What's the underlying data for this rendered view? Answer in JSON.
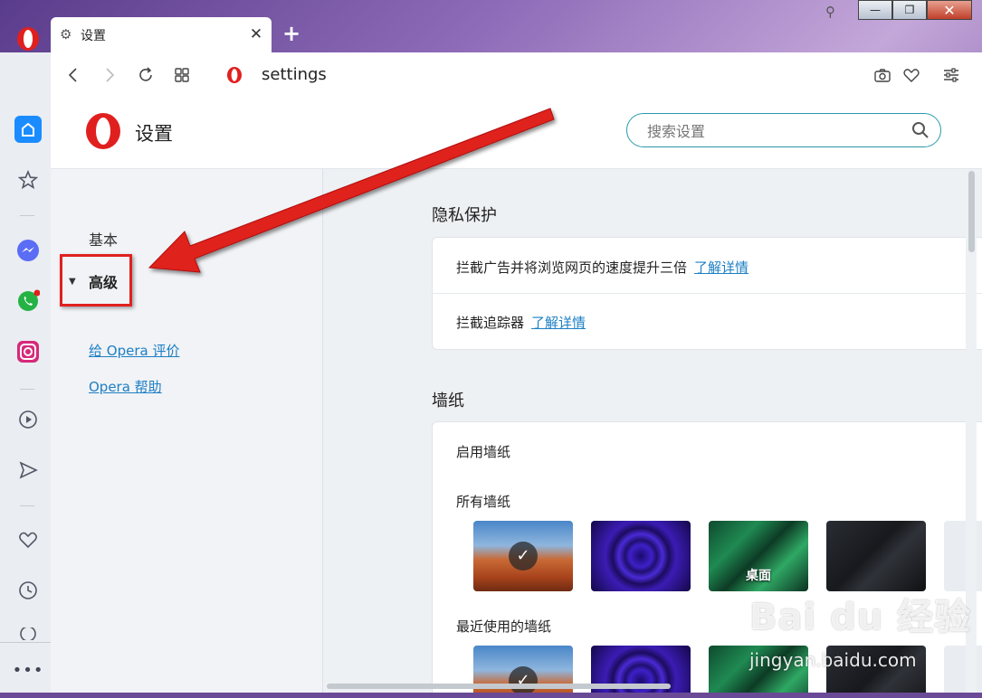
{
  "tab": {
    "title": "设置"
  },
  "address": {
    "text": "settings"
  },
  "header": {
    "title": "设置",
    "search_placeholder": "搜索设置"
  },
  "nav": {
    "basic": "基本",
    "advanced": "高级",
    "rate_link": "给 Opera 评价",
    "help_link": "Opera 帮助"
  },
  "privacy": {
    "title": "隐私保护",
    "adblock_label": "拦截广告并将浏览网页的速度提升三倍",
    "adblock_link": "了解详情",
    "tracker_label": "拦截追踪器",
    "tracker_link": "了解详情"
  },
  "wallpaper": {
    "title": "墙纸",
    "enable_label": "启用墙纸",
    "all_label": "所有墙纸",
    "recent_label": "最近使用的墙纸",
    "desktop_label": "桌面"
  },
  "window": {
    "minimize": "—",
    "maximize": "❐",
    "close": "✕"
  },
  "watermark": {
    "logo": "Bai du 经验",
    "url": "jingyan.baidu.com"
  },
  "colors": {
    "opera_red": "#e0201f",
    "accent": "#2a9aa8",
    "link": "#1d7fc4",
    "annotation_red": "#e0201f"
  }
}
